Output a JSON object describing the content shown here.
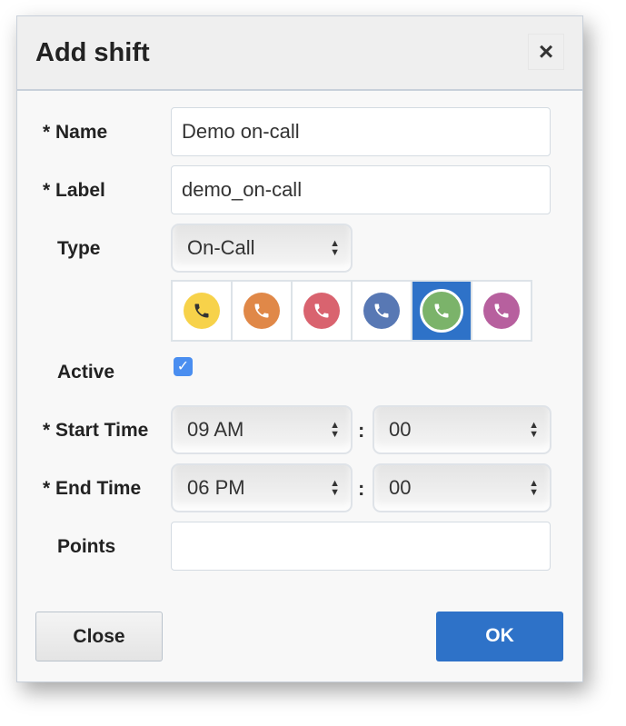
{
  "dialog": {
    "title": "Add shift",
    "close_icon": "×"
  },
  "fields": {
    "name": {
      "label": "* Name",
      "value": "Demo on-call"
    },
    "label": {
      "label": "* Label",
      "value": "demo_on-call"
    },
    "type": {
      "label": "Type",
      "value": "On-Call"
    },
    "colors": [
      {
        "color": "#f7d24a",
        "glyph": "#333333"
      },
      {
        "color": "#e08848",
        "glyph": "#ffffff"
      },
      {
        "color": "#d9636f",
        "glyph": "#ffffff"
      },
      {
        "color": "#5878b4",
        "glyph": "#ffffff"
      },
      {
        "color": "#7bb36a",
        "glyph": "#ffffff",
        "selected": true
      },
      {
        "color": "#b7609e",
        "glyph": "#ffffff"
      }
    ],
    "active": {
      "label": "Active",
      "checked": true,
      "check": "✓"
    },
    "start": {
      "label": "* Start Time",
      "hour": "09 AM",
      "minute": "00"
    },
    "end": {
      "label": "* End Time",
      "hour": "06 PM",
      "minute": "00"
    },
    "points": {
      "label": "Points",
      "value": ""
    },
    "colon": ":"
  },
  "buttons": {
    "close": "Close",
    "ok": "OK"
  }
}
